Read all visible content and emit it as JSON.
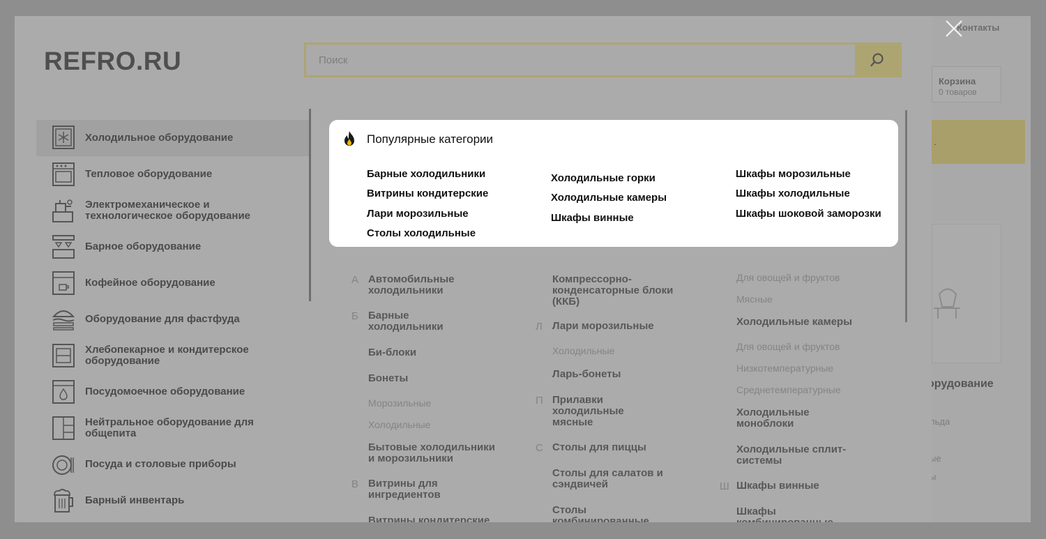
{
  "background_page": {
    "contacts_label": "Контакты",
    "cart_title": "Корзина",
    "cart_count": "0 товаров",
    "heading_fragment": "орудование",
    "lines": [
      "льда",
      "ые",
      "ы"
    ]
  },
  "header": {
    "logo": "REFRO.RU",
    "search_placeholder": "Поиск"
  },
  "sidebar": {
    "items": [
      {
        "label": "Холодильное оборудование",
        "icon": "fridge-icon"
      },
      {
        "label": "Тепловое оборудование",
        "icon": "oven-icon"
      },
      {
        "label": "Электромеханическое и технологическое оборудование",
        "icon": "meat-grinder-icon"
      },
      {
        "label": "Барное оборудование",
        "icon": "bar-icon"
      },
      {
        "label": "Кофейное оборудование",
        "icon": "coffee-machine-icon"
      },
      {
        "label": "Оборудование для фастфуда",
        "icon": "burger-icon"
      },
      {
        "label": "Хлебопекарное и кондитерское оборудование",
        "icon": "bakery-oven-icon"
      },
      {
        "label": "Посудомоечное оборудование",
        "icon": "dishwasher-icon"
      },
      {
        "label": "Нейтральное оборудование для общепита",
        "icon": "cabinet-icon"
      },
      {
        "label": "Посуда и столовые приборы",
        "icon": "plates-icon"
      },
      {
        "label": "Барный инвентарь",
        "icon": "beer-mug-icon"
      }
    ]
  },
  "popular": {
    "title": "Популярные категории",
    "icon": "fire-icon",
    "columns": [
      [
        "Барные холодильники",
        "Витрины кондитерские",
        "Лари морозильные",
        "Столы холодильные"
      ],
      [
        "Холодильные горки",
        "Холодильные камеры",
        "Шкафы винные"
      ],
      [
        "Шкафы морозильные",
        "Шкафы холодильные",
        "Шкафы шоковой заморозки"
      ]
    ]
  },
  "directory": {
    "letters": [
      "А",
      "Б",
      "В",
      "Л",
      "П",
      "С",
      "Ш"
    ],
    "col1": [
      "Автомобильные холодильники",
      "Барные холодильники",
      "Би-блоки",
      "Бонеты",
      "Морозильные",
      "Холодильные",
      "Бытовые холодильники и морозильники",
      "Витрины для ингредиентов",
      "Витрины кондитерские"
    ],
    "col2": [
      "Компрессорно-конденсаторные блоки (ККБ)",
      "Лари морозильные",
      "Холодильные",
      "Ларь-бонеты",
      "Прилавки холодильные мясные",
      "Столы для пиццы",
      "Столы для салатов и сэндвичей",
      "Столы комбинированные"
    ],
    "col3": [
      "Для овощей и фруктов",
      "Мясные",
      "Холодильные камеры",
      "Для овощей и фруктов",
      "Низкотемпературные",
      "Среднетемпературные",
      "Холодильные моноблоки",
      "Холодильные сплит-системы",
      "Шкафы винные",
      "Шкафы комбинированные"
    ]
  }
}
